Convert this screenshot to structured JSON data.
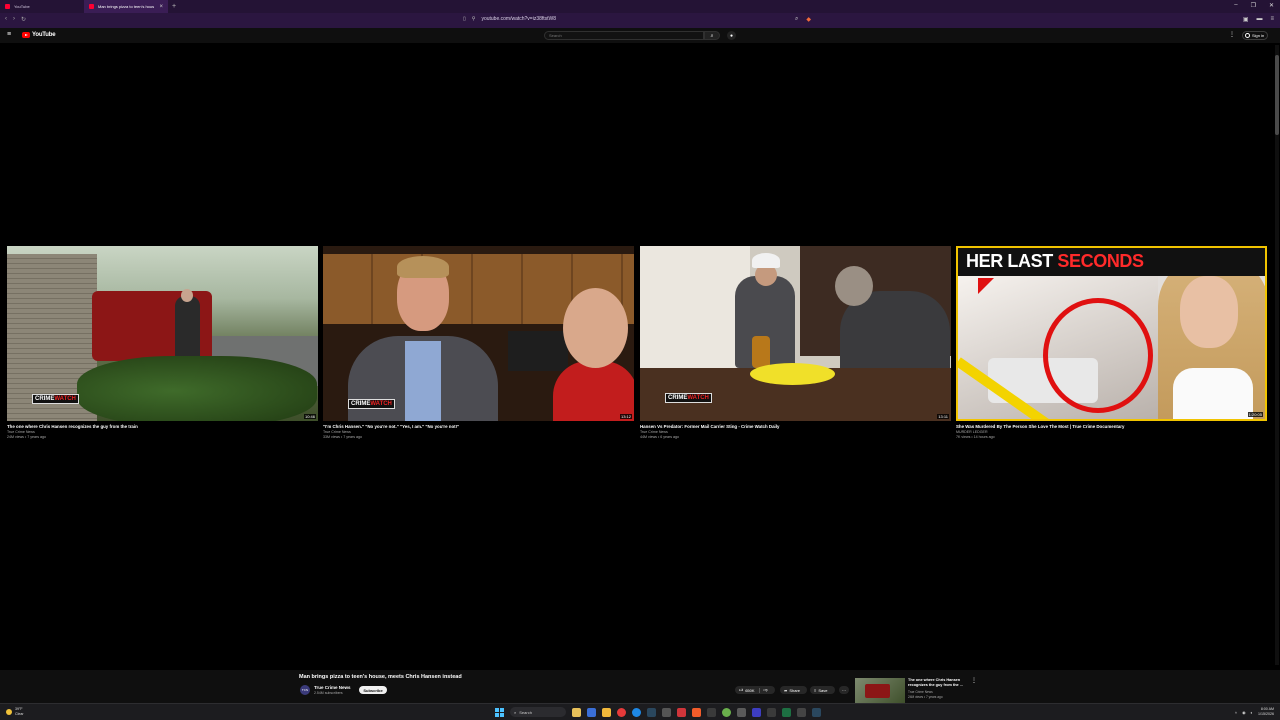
{
  "browser": {
    "tabs": [
      {
        "title": "YouTube",
        "active": false
      },
      {
        "title": "Man brings pizza to teen's hous",
        "active": true
      }
    ],
    "url": "youtube.com/watch?v=iz38ftstW8"
  },
  "youtube": {
    "logo_text": "YouTube",
    "search_placeholder": "Search",
    "sign_in": "Sign in"
  },
  "videos": [
    {
      "title": "The one where Chris Hansen recognizes the guy from the train",
      "channel": "True Crime News",
      "meta": "24M views • 7 years ago",
      "duration": "10:46",
      "badge_white": "CRIME",
      "badge_red": "WATCH"
    },
    {
      "title": "\"I'm Chris Hansen.\" \"No you're not.\" \"Yes, I am.\" \"No you're not!\"",
      "channel": "True Crime News",
      "meta": "33M views • 7 years ago",
      "duration": "13:12",
      "badge_white": "CRIME",
      "badge_red": "WATCH"
    },
    {
      "title": "Hansen Vs Predator: Former Mail Carrier Sting - Crime Watch Daily",
      "channel": "True Crime News",
      "meta": "44M views • 6 years ago",
      "duration": "13:11",
      "badge_white": "CRIME",
      "badge_red": "WATCH"
    },
    {
      "title": "She Was Murdered By The Person She Love The Most | True Crime Documentary",
      "channel": "MURDER LEDGER",
      "meta": "7K views • 14 hours ago",
      "duration": "1:20:05",
      "thumb_headline_white": "HER LAST",
      "thumb_headline_red": "SECONDS"
    }
  ],
  "now_playing": {
    "title": "Man brings pizza to teen's house, meets Chris Hansen instead",
    "channel": "True Crime News",
    "subscribers": "2.54M subscribers",
    "subscribe_label": "Subscribe",
    "likes": "650K",
    "share_label": "Share",
    "save_label": "Save",
    "avatar_text": "TCN"
  },
  "up_next": {
    "title": "The one where Chris Hansen recognizes the guy from the ...",
    "channel": "True Crime News",
    "meta": "24M views • 7 years ago"
  },
  "taskbar": {
    "temperature": "39°F",
    "condition": "Clear",
    "search_label": "Search",
    "time": "8:00 AM",
    "date": "1/15/2026"
  },
  "colors": {
    "accent_red": "#ff0000",
    "browser_purple": "#2b1640",
    "yt_dark": "#0f0f0f"
  }
}
